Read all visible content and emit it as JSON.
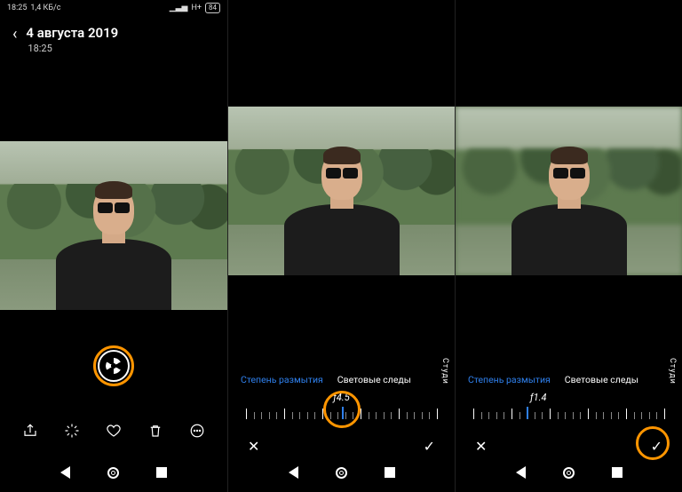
{
  "status": {
    "time": "18:25",
    "net": "1,4 КБ/с",
    "signal": "H+",
    "battery": "84"
  },
  "viewer": {
    "date": "4 августа 2019",
    "time": "18:25",
    "actions": {
      "share": "Share",
      "effects": "Effects",
      "favorite": "Favorite",
      "delete": "Delete",
      "more": "More"
    }
  },
  "editor": {
    "tabs": {
      "blur": "Степень размытия",
      "light": "Световые следы",
      "studio": "Студи"
    },
    "aperture_mid": "ƒ4.5",
    "aperture_low": "ƒ1.4"
  },
  "nav": {
    "back": "Back",
    "home": "Home",
    "recent": "Recent"
  },
  "edit_actions": {
    "cancel": "✕",
    "confirm": "✓"
  }
}
